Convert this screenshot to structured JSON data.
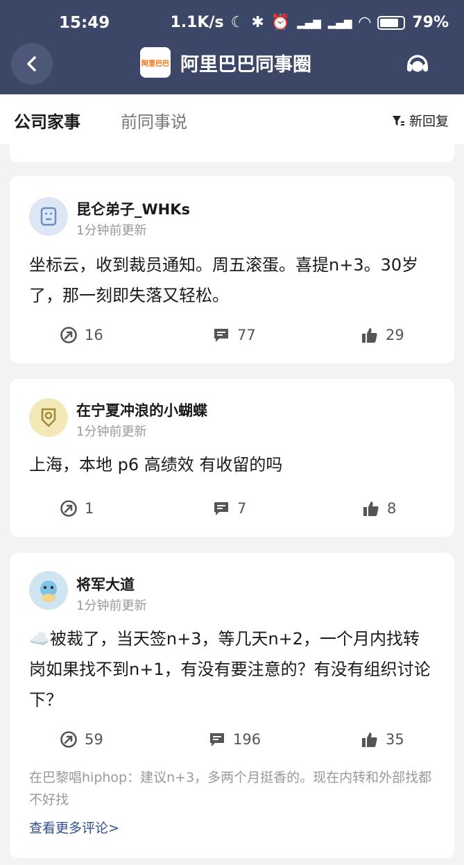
{
  "status_bar": {
    "time": "15:49",
    "net_speed": "1.1K/s",
    "battery": "79%"
  },
  "nav": {
    "title": "阿里巴巴同事圈",
    "logo_text": "阿里巴巴"
  },
  "tabs": [
    {
      "label": "公司家事",
      "active": true
    },
    {
      "label": "前同事说",
      "active": false
    }
  ],
  "sort": {
    "label": "新回复"
  },
  "posts": [
    {
      "username": "昆仑弟子_WHKs",
      "updated": "1分钟前更新",
      "content": "坐标云，收到裁员通知。周五滚蛋。喜提n+3。30岁了，那一刻即失落又轻松。",
      "shares": "16",
      "comments": "77",
      "likes": "29"
    },
    {
      "username": "在宁夏冲浪的小蝴蝶",
      "updated": "1分钟前更新",
      "content": "上海，本地 p6  高绩效 有收留的吗",
      "shares": "1",
      "comments": "7",
      "likes": "8"
    },
    {
      "username": "将军大道",
      "updated": "1分钟前更新",
      "content": "☁️被裁了，当天签n+3，等几天n+2，一个月内找转岗如果找不到n+1，有没有要注意的？有没有组织讨论下？",
      "shares": "59",
      "comments": "196",
      "likes": "35",
      "top_comment": "在巴黎唱hiphop：建议n+3，多两个月挺香的。现在内转和外部找都不好找",
      "more_comments": "查看更多评论>"
    }
  ],
  "colors": {
    "header_bg": "#3c4768",
    "page_bg": "#f2f3f5",
    "link": "#2e4e90"
  }
}
